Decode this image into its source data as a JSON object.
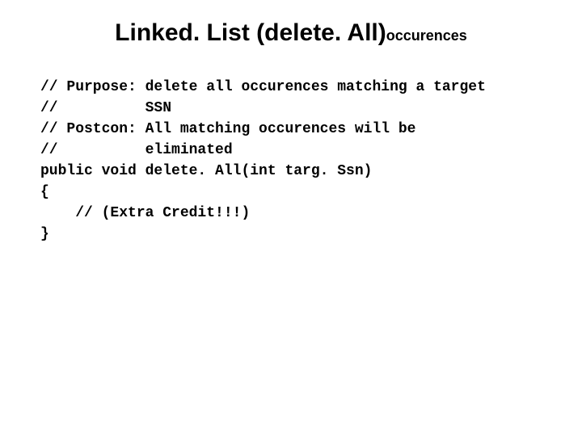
{
  "title": {
    "main": "Linked. List (delete. All)",
    "sub": "occurences"
  },
  "code": {
    "l1": "// Purpose: delete all occurences matching a target",
    "l2": "//          SSN",
    "l3": "// Postcon: All matching occurences will be",
    "l4": "//          eliminated",
    "l5": "public void delete. All(int targ. Ssn)",
    "l6": "{",
    "l7": "    // (Extra Credit!!!)",
    "l8": "}"
  }
}
